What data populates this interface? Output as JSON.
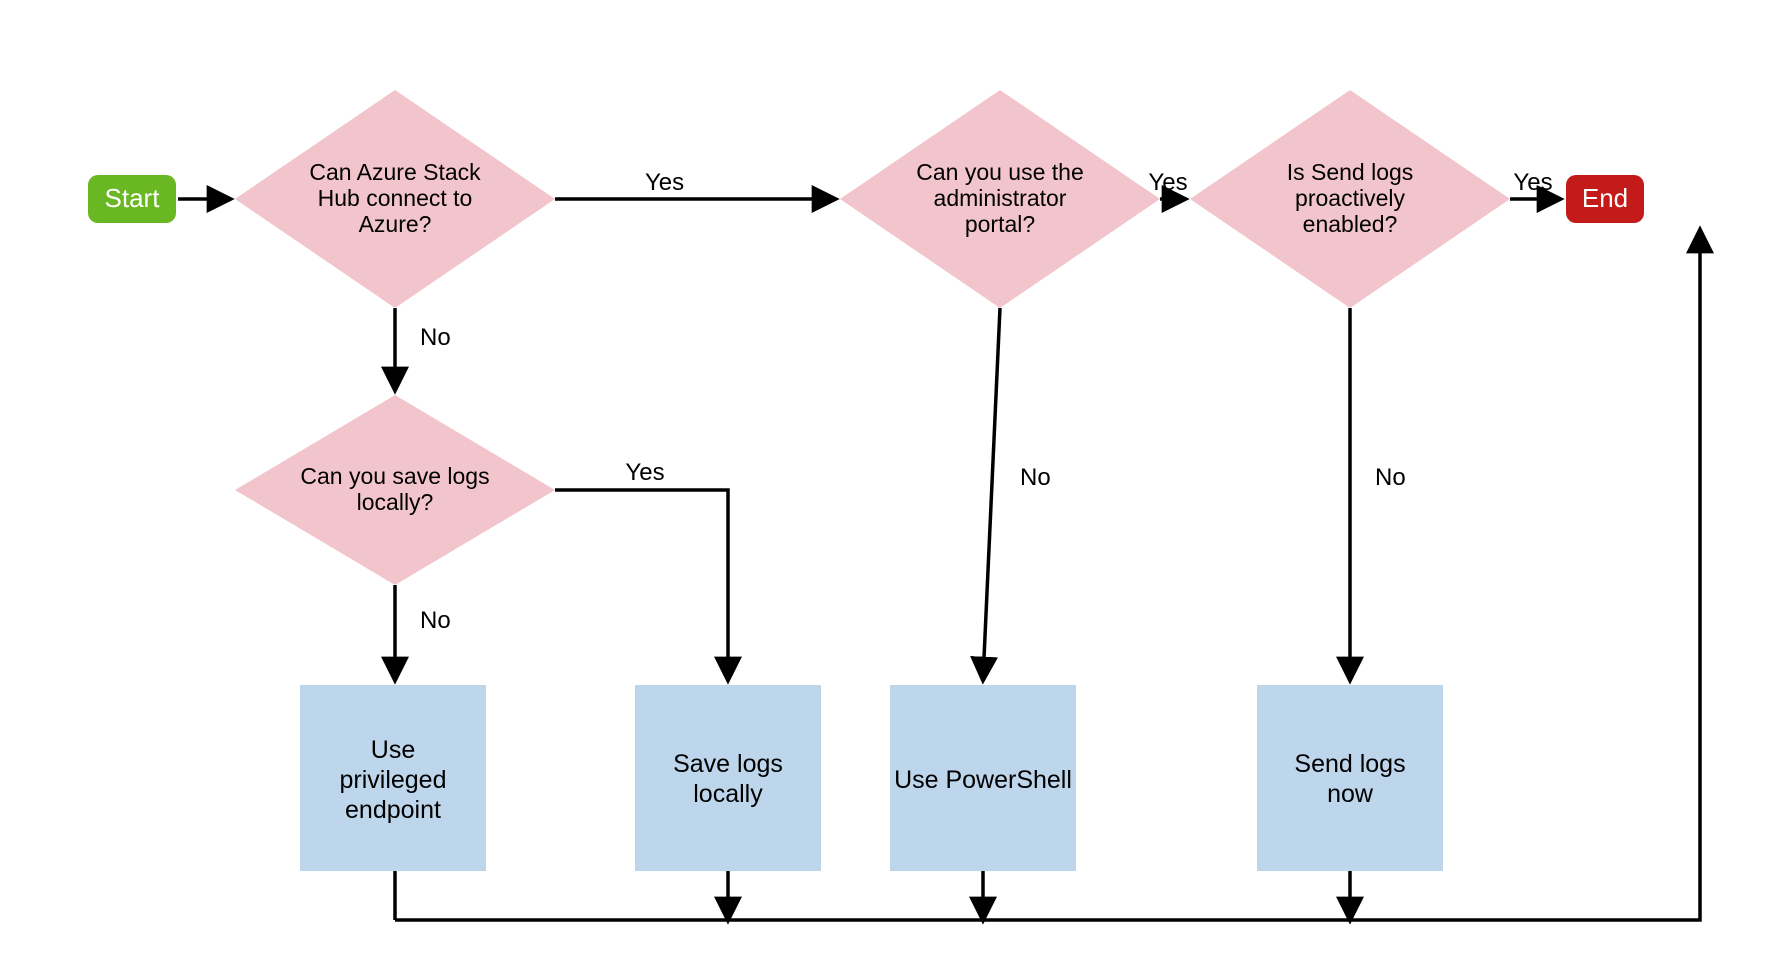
{
  "nodes": {
    "start": {
      "label": "Start"
    },
    "end": {
      "label": "End"
    },
    "d1": {
      "lines": [
        "Can Azure Stack",
        "Hub connect to",
        "Azure?"
      ]
    },
    "d2": {
      "lines": [
        "Can you use the",
        "administrator",
        "portal?"
      ]
    },
    "d3": {
      "lines": [
        "Is Send logs",
        "proactively",
        "enabled?"
      ]
    },
    "d4": {
      "lines": [
        "Can you save logs",
        "locally?"
      ]
    },
    "p1": {
      "lines": [
        "Use",
        "privileged",
        "endpoint"
      ]
    },
    "p2": {
      "lines": [
        "Save logs",
        "locally"
      ]
    },
    "p3": {
      "lines": [
        "Use PowerShell"
      ]
    },
    "p4": {
      "lines": [
        "Send logs",
        "now"
      ]
    }
  },
  "edges": {
    "yes": "Yes",
    "no": "No"
  }
}
